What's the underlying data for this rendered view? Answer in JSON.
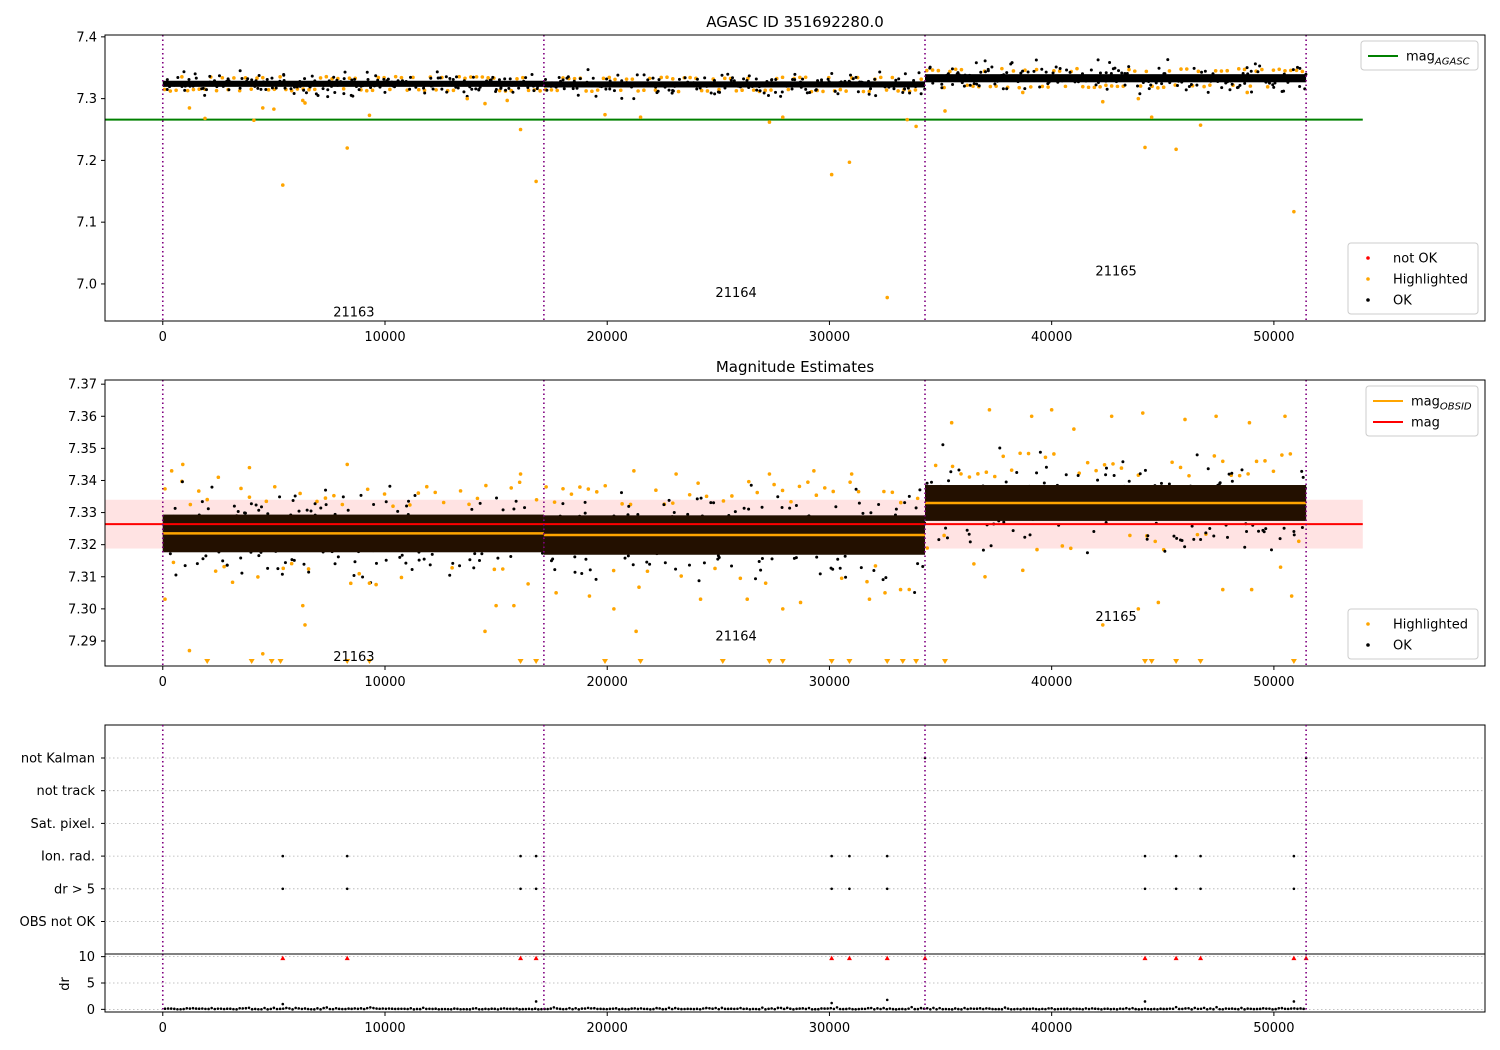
{
  "colors": {
    "ok": "#000000",
    "highlighted": "#ffa500",
    "not_ok": "#ff0000",
    "mag_agasc": "#008000",
    "mag_obsid": "#ffa500",
    "mag": "#ff0000",
    "mag_band": "#ffcccc",
    "obs_boundary": "#800080",
    "grid": "#b0b0b0"
  },
  "chart_data": [
    {
      "type": "scatter",
      "title": "AGASC ID 351692280.0",
      "xlim": [
        -2600,
        59500
      ],
      "ylim": [
        6.94,
        7.403
      ],
      "xticks": [
        0,
        10000,
        20000,
        30000,
        40000,
        50000
      ],
      "yticks": [
        7.0,
        7.1,
        7.2,
        7.3,
        7.4
      ],
      "ytick_labels": [
        "7.0",
        "7.1",
        "7.2",
        "7.3",
        "7.4"
      ],
      "obs_boundaries": [
        0,
        17150,
        34300,
        51450
      ],
      "obsids": [
        {
          "label": "21163",
          "x": 8600,
          "y": 6.955
        },
        {
          "label": "21164",
          "x": 25800,
          "y": 6.987
        },
        {
          "label": "21165",
          "x": 42900,
          "y": 7.022
        }
      ],
      "ok_bands": [
        {
          "x0": 0,
          "x1": 17150,
          "center": 7.324,
          "spread": 0.009
        },
        {
          "x0": 17150,
          "x1": 34300,
          "center": 7.323,
          "spread": 0.009
        },
        {
          "x0": 34300,
          "x1": 51450,
          "center": 7.333,
          "spread": 0.012
        }
      ],
      "hlines": [
        {
          "name": "mag_AGASC",
          "y": 7.266,
          "x0": -2600,
          "x1": 54000,
          "color": "#008000"
        }
      ],
      "highlighted_points": [
        [
          1200,
          7.285
        ],
        [
          1900,
          7.268
        ],
        [
          4100,
          7.265
        ],
        [
          4500,
          7.285
        ],
        [
          5000,
          7.283
        ],
        [
          5400,
          7.16
        ],
        [
          6300,
          7.297
        ],
        [
          6400,
          7.293
        ],
        [
          8300,
          7.22
        ],
        [
          9300,
          7.273
        ],
        [
          13700,
          7.3
        ],
        [
          14500,
          7.292
        ],
        [
          15500,
          7.297
        ],
        [
          16100,
          7.25
        ],
        [
          16800,
          7.166
        ],
        [
          19900,
          7.274
        ],
        [
          21500,
          7.27
        ],
        [
          27300,
          7.262
        ],
        [
          27900,
          7.27
        ],
        [
          30100,
          7.177
        ],
        [
          30900,
          7.197
        ],
        [
          32600,
          6.978
        ],
        [
          33500,
          7.266
        ],
        [
          33900,
          7.255
        ],
        [
          35200,
          7.28
        ],
        [
          42300,
          7.295
        ],
        [
          43900,
          7.3
        ],
        [
          44200,
          7.221
        ],
        [
          44500,
          7.27
        ],
        [
          45600,
          7.218
        ],
        [
          46700,
          7.257
        ],
        [
          50900,
          7.117
        ],
        [
          48800,
          7.31
        ],
        [
          38700,
          7.31
        ]
      ],
      "legends": [
        {
          "position": "upper right",
          "entries": [
            {
              "label": "mag",
              "sub": "AGASC",
              "kind": "line",
              "color": "#008000"
            }
          ]
        },
        {
          "position": "lower right",
          "entries": [
            {
              "label": "not OK",
              "kind": "marker",
              "color": "#ff0000"
            },
            {
              "label": "Highlighted",
              "kind": "marker",
              "color": "#ffa500"
            },
            {
              "label": "OK",
              "kind": "marker",
              "color": "#000000"
            }
          ]
        }
      ]
    },
    {
      "type": "scatter",
      "title": "Magnitude Estimates",
      "xlim": [
        -2600,
        59500
      ],
      "ylim": [
        7.2822,
        7.3713
      ],
      "xticks": [
        0,
        10000,
        20000,
        30000,
        40000,
        50000
      ],
      "yticks": [
        7.29,
        7.3,
        7.31,
        7.32,
        7.33,
        7.34,
        7.35,
        7.36,
        7.37
      ],
      "ytick_labels": [
        "7.29",
        "7.30",
        "7.31",
        "7.32",
        "7.33",
        "7.34",
        "7.35",
        "7.36",
        "7.37"
      ],
      "obs_boundaries": [
        0,
        17150,
        34300,
        51450
      ],
      "obsids": [
        {
          "label": "21163",
          "x": 8600,
          "y": 7.2853
        },
        {
          "label": "21164",
          "x": 25800,
          "y": 7.2917
        },
        {
          "label": "21165",
          "x": 42900,
          "y": 7.2977
        }
      ],
      "band": {
        "name": "mag",
        "y0": 7.3188,
        "y1": 7.334,
        "x0": -2600,
        "x1": 54000
      },
      "hlines": [
        {
          "name": "mag",
          "y": 7.3264,
          "x0": -2600,
          "x1": 54000,
          "color": "#ff0000"
        }
      ],
      "segments": [
        {
          "name": "mag_OBSID",
          "x0": 0,
          "x1": 17150,
          "y": 7.3235,
          "color": "#ffa500"
        },
        {
          "name": "mag_OBSID",
          "x0": 17150,
          "x1": 34300,
          "y": 7.323,
          "color": "#ffa500"
        },
        {
          "name": "mag_OBSID",
          "x0": 34300,
          "x1": 51450,
          "y": 7.333,
          "color": "#ffa500"
        }
      ],
      "ok_bands": [
        {
          "x0": 0,
          "x1": 17150,
          "center": 7.3235,
          "spread": 0.0065
        },
        {
          "x0": 17150,
          "x1": 34300,
          "center": 7.323,
          "spread": 0.0068
        },
        {
          "x0": 34300,
          "x1": 51450,
          "center": 7.333,
          "spread": 0.0062
        }
      ],
      "highlighted_points": [
        [
          100,
          7.303
        ],
        [
          1200,
          7.287
        ],
        [
          4500,
          7.286
        ],
        [
          6300,
          7.301
        ],
        [
          6400,
          7.295
        ],
        [
          9300,
          7.308
        ],
        [
          14500,
          7.293
        ],
        [
          15000,
          7.301
        ],
        [
          15800,
          7.301
        ],
        [
          17700,
          7.305
        ],
        [
          19200,
          7.304
        ],
        [
          20300,
          7.3
        ],
        [
          21300,
          7.293
        ],
        [
          24200,
          7.303
        ],
        [
          26300,
          7.303
        ],
        [
          27900,
          7.3
        ],
        [
          28700,
          7.302
        ],
        [
          31800,
          7.303
        ],
        [
          32500,
          7.305
        ],
        [
          33200,
          7.306
        ],
        [
          36500,
          7.314
        ],
        [
          37000,
          7.31
        ],
        [
          38700,
          7.312
        ],
        [
          42300,
          7.295
        ],
        [
          43900,
          7.3
        ],
        [
          44800,
          7.302
        ],
        [
          47700,
          7.306
        ],
        [
          49000,
          7.306
        ],
        [
          50300,
          7.313
        ],
        [
          50800,
          7.304
        ],
        [
          400,
          7.343
        ],
        [
          900,
          7.345
        ],
        [
          2500,
          7.341
        ],
        [
          3900,
          7.344
        ],
        [
          8300,
          7.345
        ],
        [
          16100,
          7.342
        ],
        [
          21200,
          7.343
        ],
        [
          23100,
          7.342
        ],
        [
          27300,
          7.342
        ],
        [
          29300,
          7.343
        ],
        [
          31000,
          7.342
        ],
        [
          35500,
          7.358
        ],
        [
          37200,
          7.362
        ],
        [
          39100,
          7.36
        ],
        [
          40000,
          7.362
        ],
        [
          41000,
          7.356
        ],
        [
          42700,
          7.36
        ],
        [
          44100,
          7.361
        ],
        [
          46000,
          7.359
        ],
        [
          47400,
          7.36
        ],
        [
          48900,
          7.358
        ],
        [
          50500,
          7.36
        ]
      ],
      "clipped_markers": [
        2000,
        4000,
        4900,
        5300,
        8300,
        9300,
        16100,
        16800,
        19900,
        21500,
        25200,
        27300,
        27900,
        30100,
        30900,
        32600,
        33300,
        33900,
        35200,
        44200,
        44500,
        45600,
        46700,
        50900
      ],
      "legends": [
        {
          "position": "upper right",
          "entries": [
            {
              "label": "mag",
              "sub": "OBSID",
              "kind": "line",
              "color": "#ffa500"
            },
            {
              "label": "mag",
              "kind": "line",
              "color": "#ff0000"
            }
          ]
        },
        {
          "position": "lower right",
          "entries": [
            {
              "label": "Highlighted",
              "kind": "marker",
              "color": "#ffa500"
            },
            {
              "label": "OK",
              "kind": "marker",
              "color": "#000000"
            }
          ]
        }
      ]
    },
    {
      "type": "scatter",
      "xlim": [
        -2600,
        59500
      ],
      "xticks": [
        0,
        10000,
        20000,
        30000,
        40000,
        50000
      ],
      "obs_boundaries": [
        0,
        17150,
        34300,
        51450
      ],
      "flag_rows": [
        "not Kalman",
        "not track",
        "Sat. pixel.",
        "Ion. rad.",
        "dr > 5",
        "OBS not OK"
      ],
      "flag_points": [
        {
          "flag": "Ion. rad.",
          "x": [
            5400,
            8300,
            16100,
            16800,
            30100,
            30900,
            32600,
            44200,
            45600,
            46700,
            50900
          ]
        },
        {
          "flag": "dr > 5",
          "x": [
            5400,
            8300,
            16100,
            16800,
            30100,
            30900,
            32600,
            44200,
            45600,
            46700,
            50900
          ]
        },
        {
          "flag": "not Kalman",
          "x": [
            34300,
            51450
          ]
        }
      ],
      "dr": {
        "ylabel": "dr",
        "ylim": [
          -0.5,
          10.5
        ],
        "yticks": [
          0,
          5,
          10
        ],
        "clipped_x": [
          5400,
          8300,
          16100,
          16800,
          30100,
          30900,
          32600,
          34300,
          44200,
          45600,
          46700,
          50900,
          51450
        ],
        "outliers": [
          [
            5400,
            1.0
          ],
          [
            16800,
            1.5
          ],
          [
            30100,
            1.2
          ],
          [
            32600,
            1.8
          ],
          [
            44200,
            1.5
          ],
          [
            50900,
            1.5
          ]
        ]
      }
    }
  ]
}
